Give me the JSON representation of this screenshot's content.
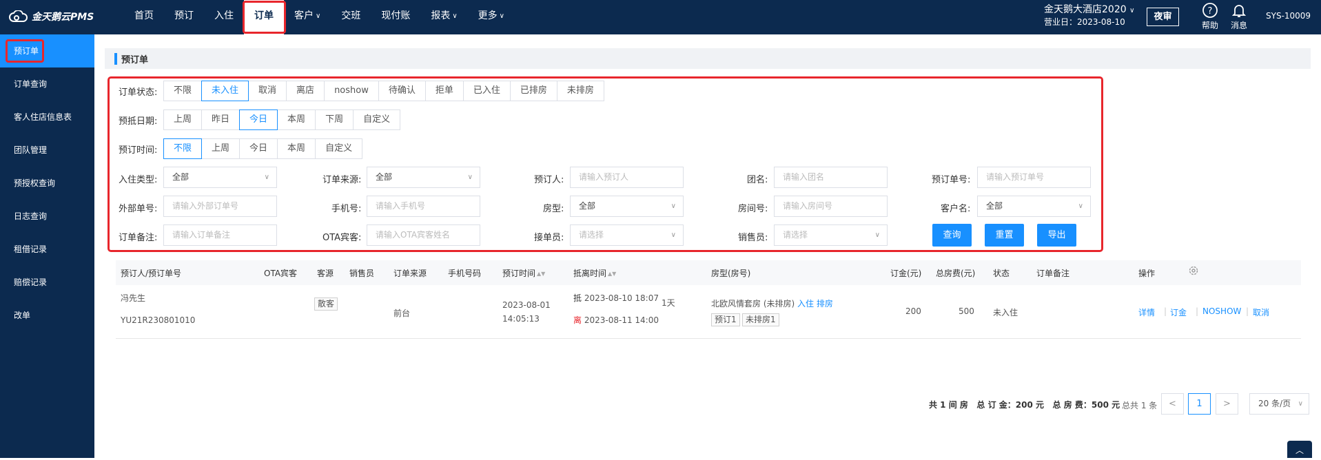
{
  "app": {
    "logo_text": "金天鹅云PMS"
  },
  "nav": [
    {
      "label": "首页",
      "chev": false
    },
    {
      "label": "预订",
      "chev": false
    },
    {
      "label": "入住",
      "chev": false
    },
    {
      "label": "订单",
      "chev": false,
      "active": true
    },
    {
      "label": "客户",
      "chev": true
    },
    {
      "label": "交班",
      "chev": false
    },
    {
      "label": "现付账",
      "chev": false
    },
    {
      "label": "报表",
      "chev": true
    },
    {
      "label": "更多",
      "chev": true
    }
  ],
  "header": {
    "hotel_name": "金天鹅大酒店2020",
    "business_day": "营业日：2023-08-10",
    "night_audit": "夜审",
    "help": "帮助",
    "message": "消息",
    "user": "SYS-10009"
  },
  "sidebar": [
    "预订单",
    "订单查询",
    "客人住店信息表",
    "团队管理",
    "预授权查询",
    "日志查询",
    "租借记录",
    "赔偿记录",
    "改单"
  ],
  "page_title": "预订单",
  "filters": {
    "order_status": {
      "label": "订单状态:",
      "options": [
        "不限",
        "未入住",
        "取消",
        "离店",
        "noshow",
        "待确认",
        "拒单",
        "已入住",
        "已排房",
        "未排房"
      ],
      "selected": "未入住"
    },
    "arrival_date": {
      "label": "预抵日期:",
      "options": [
        "上周",
        "昨日",
        "今日",
        "本周",
        "下周",
        "自定义"
      ],
      "selected": "今日"
    },
    "booking_time": {
      "label": "预订时间:",
      "options": [
        "不限",
        "上周",
        "今日",
        "本周",
        "自定义"
      ],
      "selected": "不限"
    },
    "checkin_type": {
      "label": "入住类型:",
      "value": "全部"
    },
    "order_source": {
      "label": "订单来源:",
      "value": "全部"
    },
    "booker": {
      "label": "预订人:",
      "placeholder": "请输入预订人"
    },
    "group_name": {
      "label": "团名:",
      "placeholder": "请输入团名"
    },
    "booking_no": {
      "label": "预订单号:",
      "placeholder": "请输入预订单号"
    },
    "external_no": {
      "label": "外部单号:",
      "placeholder": "请输入外部订单号"
    },
    "phone": {
      "label": "手机号:",
      "placeholder": "请输入手机号"
    },
    "room_type": {
      "label": "房型:",
      "value": "全部"
    },
    "room_no": {
      "label": "房间号:",
      "placeholder": "请输入房间号"
    },
    "customer_name": {
      "label": "客户名:",
      "value": "全部"
    },
    "order_remark": {
      "label": "订单备注:",
      "placeholder": "请输入订单备注"
    },
    "ota_guest": {
      "label": "OTA宾客:",
      "placeholder": "请输入OTA宾客姓名"
    },
    "receiver": {
      "label": "接单员:",
      "placeholder": "请选择"
    },
    "salesperson": {
      "label": "销售员:",
      "placeholder": "请选择"
    },
    "buttons": {
      "search": "查询",
      "reset": "重置",
      "export": "导出"
    }
  },
  "table": {
    "headers": [
      "预订人/预订单号",
      "OTA宾客",
      "客源",
      "销售员",
      "订单来源",
      "手机号码",
      "预订时间",
      "抵离时间",
      "房型(房号)",
      "订金(元)",
      "总房费(元)",
      "状态",
      "订单备注",
      "操作"
    ],
    "rows": [
      {
        "booker": "冯先生",
        "booking_no": "YU21R230801010",
        "guest_source": "散客",
        "order_source": "前台",
        "booking_date": "2023-08-01",
        "booking_clock": "14:05:13",
        "arrive_tag": "抵",
        "arrive": "2023-08-10 18:07",
        "leave_tag": "离",
        "leave": "2023-08-11 14:00",
        "nights": "1天",
        "room_type": "北欧风情套房 (未排房)",
        "room_actions": [
          "入住",
          "排房"
        ],
        "room_tags": [
          "预订1",
          "未排房1"
        ],
        "deposit": "200",
        "total": "500",
        "status": "未入住",
        "actions": [
          "详情",
          "订金",
          "NOSHOW",
          "取消"
        ]
      }
    ]
  },
  "footer": {
    "summary": "共 1 间 房   总 订 金：200 元   总 房 费：500 元",
    "total_count": "总共 1 条",
    "page": "1",
    "page_size": "20 条/页"
  }
}
